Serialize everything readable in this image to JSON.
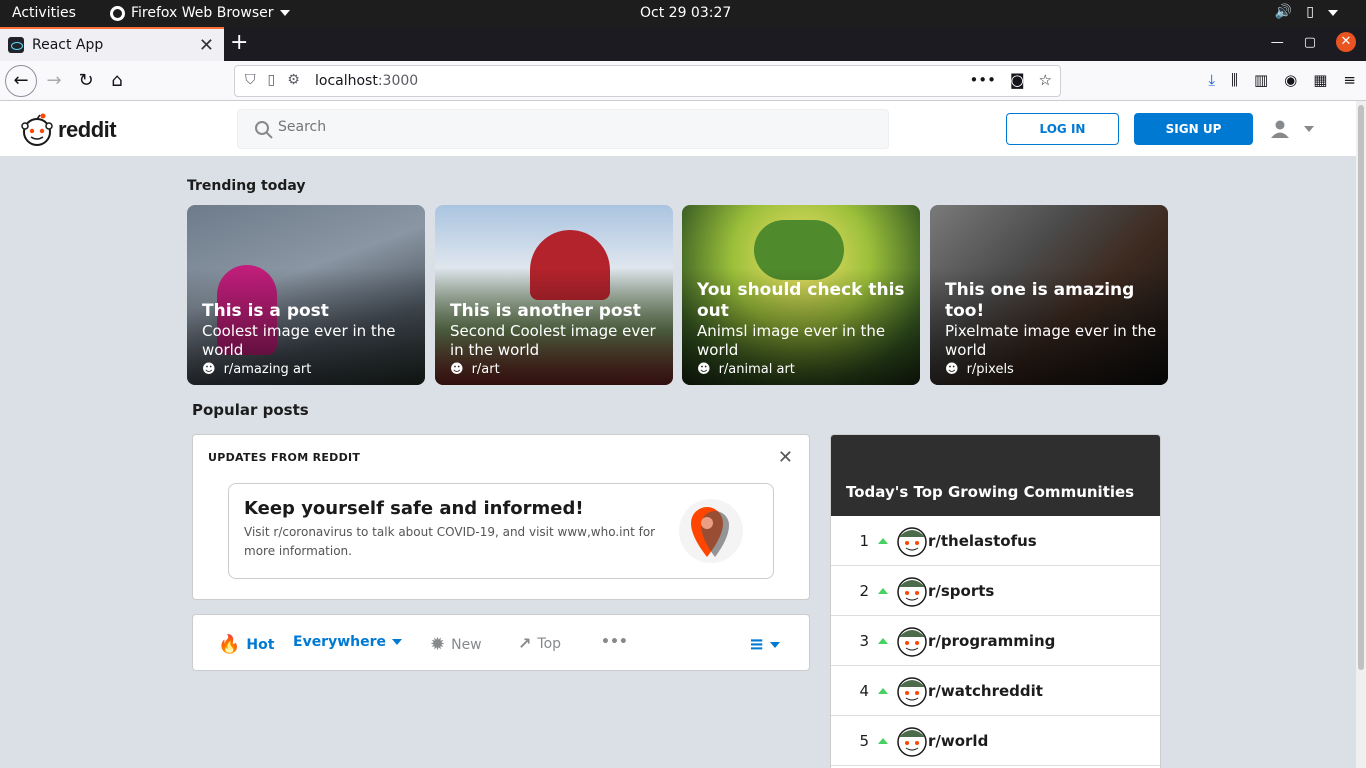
{
  "os_bar": {
    "activities": "Activities",
    "app_name": "Firefox Web Browser",
    "clock": "Oct 29  03:27"
  },
  "browser": {
    "tab_title": "React App",
    "url_host": "localhost",
    "url_port": ":3000"
  },
  "header": {
    "logo_text": "reddit",
    "search_placeholder": "Search",
    "login_label": "LOG IN",
    "signup_label": "SIGN UP"
  },
  "trending": {
    "label": "Trending today",
    "cards": [
      {
        "title": "This is a post",
        "desc": "Coolest image ever in the world",
        "sub": "r/amazing art"
      },
      {
        "title": "This is another post",
        "desc": "Second Coolest image ever in the world",
        "sub": "r/art"
      },
      {
        "title": "You should check this out",
        "desc": "Animsl image ever in the world",
        "sub": "r/animal art"
      },
      {
        "title": "This one is amazing too!",
        "desc": "Pixelmate image ever in the world",
        "sub": "r/pixels"
      }
    ]
  },
  "popular": {
    "label": "Popular posts",
    "updates": {
      "title": "UPDATES FROM REDDIT",
      "heading": "Keep yourself safe and informed!",
      "text": "Visit r/coronavirus to talk about COVID-19, and visit www,who.int for more information."
    },
    "sort": {
      "hot": "Hot",
      "everywhere": "Everywhere",
      "new": "New",
      "top": "Top"
    }
  },
  "communities": {
    "title": "Today's Top Growing Communities",
    "rows": [
      {
        "rank": "1",
        "name": "r/thelastofus"
      },
      {
        "rank": "2",
        "name": "r/sports"
      },
      {
        "rank": "3",
        "name": "r/programming"
      },
      {
        "rank": "4",
        "name": "r/watchreddit"
      },
      {
        "rank": "5",
        "name": "r/world"
      }
    ]
  },
  "colors": {
    "brand_blue": "#0079d3",
    "reddit_orange": "#ff4500",
    "upvote_green": "#46d160",
    "page_bg": "#dae0e6"
  }
}
